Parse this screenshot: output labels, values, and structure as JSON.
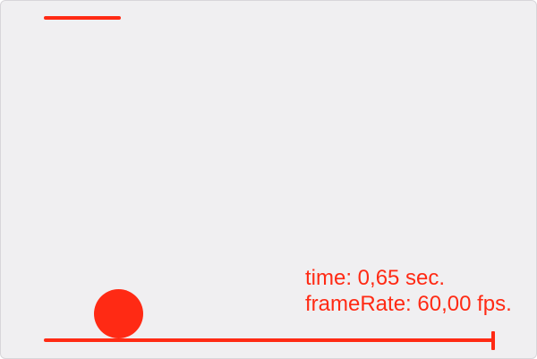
{
  "colors": {
    "accent": "#ff2a14",
    "background": "#f0eff1"
  },
  "readout": {
    "time_text": "time: 0,65 sec.",
    "framerate_text": "frameRate: 60,00 fps."
  }
}
